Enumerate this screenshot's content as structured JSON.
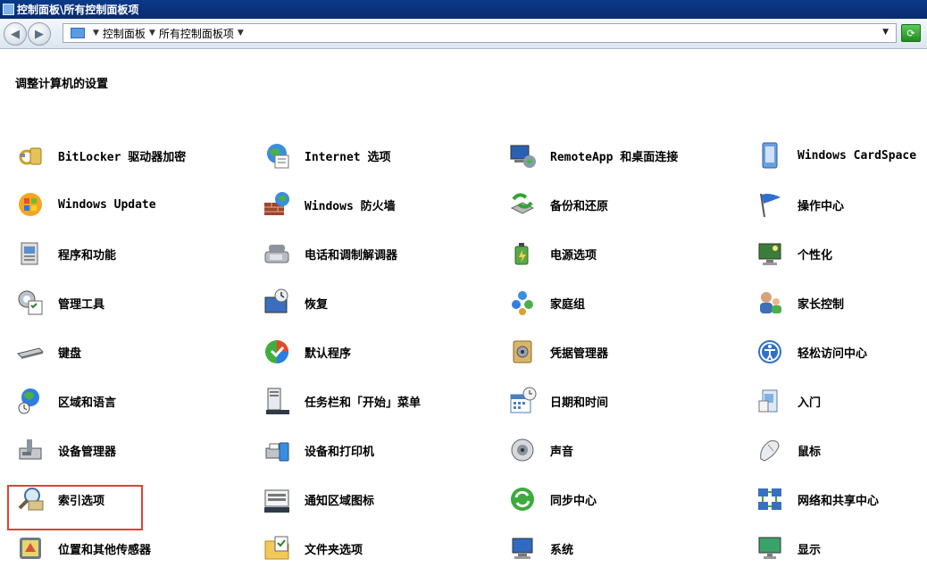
{
  "window": {
    "title": "控制面板\\所有控制面板项"
  },
  "address": {
    "segments": [
      "控制面板",
      "所有控制面板项"
    ]
  },
  "page": {
    "heading": "调整计算机的设置"
  },
  "items": [
    [
      {
        "label": "BitLocker 驱动器加密",
        "icon": "bitlocker-icon"
      },
      {
        "label": "Internet 选项",
        "icon": "internet-options-icon"
      },
      {
        "label": "RemoteApp 和桌面连接",
        "icon": "remoteapp-icon"
      },
      {
        "label": "Windows CardSpace",
        "icon": "cardspace-icon"
      }
    ],
    [
      {
        "label": "Windows Update",
        "icon": "windows-update-icon"
      },
      {
        "label": "Windows 防火墙",
        "icon": "firewall-icon"
      },
      {
        "label": "备份和还原",
        "icon": "backup-restore-icon"
      },
      {
        "label": "操作中心",
        "icon": "action-center-flag-icon"
      }
    ],
    [
      {
        "label": "程序和功能",
        "icon": "programs-features-icon"
      },
      {
        "label": "电话和调制解调器",
        "icon": "phone-modem-icon"
      },
      {
        "label": "电源选项",
        "icon": "power-options-icon"
      },
      {
        "label": "个性化",
        "icon": "personalization-icon"
      }
    ],
    [
      {
        "label": "管理工具",
        "icon": "admin-tools-icon"
      },
      {
        "label": "恢复",
        "icon": "recovery-icon"
      },
      {
        "label": "家庭组",
        "icon": "homegroup-icon"
      },
      {
        "label": "家长控制",
        "icon": "parental-controls-icon"
      }
    ],
    [
      {
        "label": "键盘",
        "icon": "keyboard-icon"
      },
      {
        "label": "默认程序",
        "icon": "default-programs-icon"
      },
      {
        "label": "凭据管理器",
        "icon": "credential-manager-icon"
      },
      {
        "label": "轻松访问中心",
        "icon": "ease-of-access-icon"
      }
    ],
    [
      {
        "label": "区域和语言",
        "icon": "region-language-icon"
      },
      {
        "label": "任务栏和「开始」菜单",
        "icon": "taskbar-start-menu-icon"
      },
      {
        "label": "日期和时间",
        "icon": "date-time-icon"
      },
      {
        "label": "入门",
        "icon": "getting-started-icon"
      }
    ],
    [
      {
        "label": "设备管理器",
        "icon": "device-manager-icon"
      },
      {
        "label": "设备和打印机",
        "icon": "devices-printers-icon"
      },
      {
        "label": "声音",
        "icon": "sound-icon"
      },
      {
        "label": "鼠标",
        "icon": "mouse-icon"
      }
    ],
    [
      {
        "label": "索引选项",
        "icon": "indexing-options-icon",
        "highlighted": true
      },
      {
        "label": "通知区域图标",
        "icon": "notification-area-icon"
      },
      {
        "label": "同步中心",
        "icon": "sync-center-icon"
      },
      {
        "label": "网络和共享中心",
        "icon": "network-sharing-icon"
      }
    ],
    [
      {
        "label": "位置和其他传感器",
        "icon": "location-sensors-icon"
      },
      {
        "label": "文件夹选项",
        "icon": "folder-options-icon"
      },
      {
        "label": "系统",
        "icon": "system-icon"
      },
      {
        "label": "显示",
        "icon": "display-icon"
      }
    ]
  ]
}
